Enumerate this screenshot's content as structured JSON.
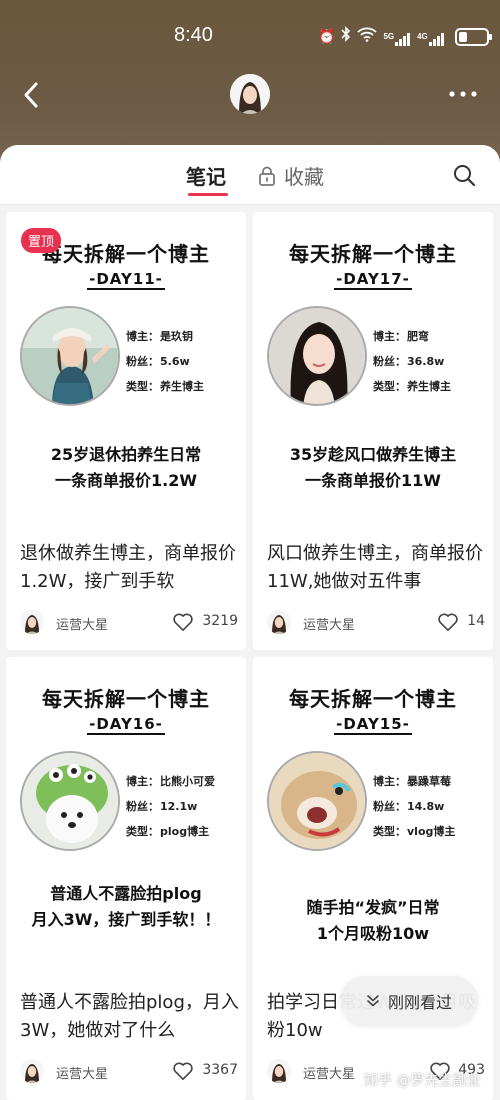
{
  "status_bar": {
    "time": "8:40",
    "net1": "5G",
    "net2": "4G"
  },
  "header": {
    "back_icon": "chevron-left-icon",
    "more_icon": "more-horizontal-icon"
  },
  "tabs": {
    "notes": "笔记",
    "favorites": "收藏",
    "favorites_icon": "lock-icon",
    "search_icon": "search-icon",
    "accent": "#e8314f"
  },
  "cards": [
    {
      "pinned": "置顶",
      "cover_title": "每天拆解一个博主",
      "day": "-DAY11-",
      "stats": [
        {
          "label": "博主：",
          "value": "是玖钥"
        },
        {
          "label": "粉丝：",
          "value": "5.6w"
        },
        {
          "label": "类型：",
          "value": "养生博主"
        }
      ],
      "headline1": "25岁退休拍养生日常",
      "headline2": "一条商单报价1.2W",
      "title": "退休做养生博主，商单报价1.2W，接广到手软",
      "author": "运营大星",
      "likes": "3219"
    },
    {
      "cover_title": "每天拆解一个博主",
      "day": "-DAY17-",
      "stats": [
        {
          "label": "博主：",
          "value": "肥弯"
        },
        {
          "label": "粉丝：",
          "value": "36.8w"
        },
        {
          "label": "类型：",
          "value": "养生博主"
        }
      ],
      "headline1": "35岁趁风口做养生博主",
      "headline2": "一条商单报价11W",
      "title": "风口做养生博主，商单报价11W,她做对五件事",
      "author": "运营大星",
      "likes": "14"
    },
    {
      "cover_title": "每天拆解一个博主",
      "day": "-DAY16-",
      "stats": [
        {
          "label": "博主：",
          "value": "比熊小可爱"
        },
        {
          "label": "粉丝：",
          "value": "12.1w"
        },
        {
          "label": "类型：",
          "value": "plog博主"
        }
      ],
      "headline1": "普通人不露脸拍plog",
      "headline2": "月入3W，接广到手软！！",
      "title": "普通人不露脸拍plog，月入3W，她做对了什么",
      "author": "运营大星",
      "likes": "3367"
    },
    {
      "cover_title": "每天拆解一个博主",
      "day": "-DAY15-",
      "stats": [
        {
          "label": "博主：",
          "value": "暴躁草莓"
        },
        {
          "label": "粉丝：",
          "value": "14.8w"
        },
        {
          "label": "类型：",
          "value": "vlog博主"
        }
      ],
      "headline1": "随手拍“发疯”日常",
      "headline2": "1个月吸粉10w",
      "title": "拍学习日常过W，1个月吸粉10w",
      "author": "运营大星",
      "likes": "493"
    }
  ],
  "floating": {
    "just_seen": "刚刚看过",
    "just_seen_icon": "double-chevron-down-icon"
  },
  "watermark": "知乎 @罗先生副业"
}
